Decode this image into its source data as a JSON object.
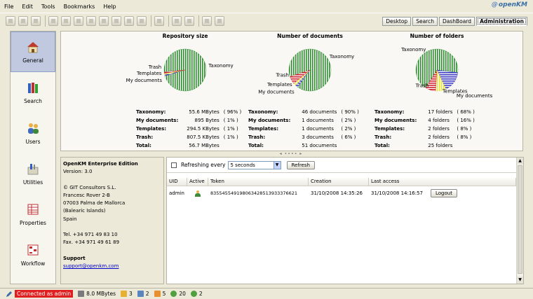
{
  "menu": [
    "File",
    "Edit",
    "Tools",
    "Bookmarks",
    "Help"
  ],
  "logo": "openKM",
  "tabs": [
    "Desktop",
    "Search",
    "DashBoard",
    "Administration"
  ],
  "active_tab": "Administration",
  "nav": [
    {
      "label": "General",
      "icon": "house-icon",
      "active": true
    },
    {
      "label": "Search",
      "icon": "books-icon"
    },
    {
      "label": "Users",
      "icon": "users-icon"
    },
    {
      "label": "Utilities",
      "icon": "tools-icon"
    },
    {
      "label": "Properties",
      "icon": "properties-icon"
    },
    {
      "label": "Workflow",
      "icon": "workflow-icon"
    }
  ],
  "colors": {
    "taxonomy": "#2c8f2c",
    "my_documents": "#3a3ac0",
    "templates": "#e8e830",
    "trash": "#d02030"
  },
  "charts": [
    {
      "title": "Repository size",
      "labels": {
        "trash": "Trash",
        "templates": "Templates",
        "mydocs": "My documents",
        "taxonomy": "Taxonomy"
      },
      "rows": [
        {
          "label": "Taxonomy:",
          "value": "55.6 MBytes",
          "pct": "( 96% )"
        },
        {
          "label": "My documents:",
          "value": "895 Bytes",
          "pct": "( 1% )"
        },
        {
          "label": "Templates:",
          "value": "294.5 KBytes",
          "pct": "( 1% )"
        },
        {
          "label": "Trash:",
          "value": "807.5 KBytes",
          "pct": "( 1% )"
        },
        {
          "label": "Total:",
          "value": "56.7 MBytes",
          "pct": ""
        }
      ]
    },
    {
      "title": "Number of documents",
      "labels": {
        "trash": "Trash",
        "templates": "Templates",
        "mydocs": "My documents",
        "taxonomy": "Taxonomy"
      },
      "rows": [
        {
          "label": "Taxonomy:",
          "value": "46 documents",
          "pct": "( 90% )"
        },
        {
          "label": "My documents:",
          "value": "1 documents",
          "pct": "( 2% )"
        },
        {
          "label": "Templates:",
          "value": "1 documents",
          "pct": "( 2% )"
        },
        {
          "label": "Trash:",
          "value": "3 documents",
          "pct": "( 6% )"
        },
        {
          "label": "Total:",
          "value": "51 documents",
          "pct": ""
        }
      ]
    },
    {
      "title": "Number of folders",
      "labels": {
        "trash": "Trash",
        "templates": "Templates",
        "mydocs": "My documents",
        "taxonomy": "Taxonomy"
      },
      "rows": [
        {
          "label": "Taxonomy:",
          "value": "17 folders",
          "pct": "( 68% )"
        },
        {
          "label": "My documents:",
          "value": "4 folders",
          "pct": "( 16% )"
        },
        {
          "label": "Templates:",
          "value": "2 folders",
          "pct": "( 8% )"
        },
        {
          "label": "Trash:",
          "value": "2 folders",
          "pct": "( 8% )"
        },
        {
          "label": "Total:",
          "value": "25 folders",
          "pct": ""
        }
      ]
    }
  ],
  "chart_data": [
    {
      "type": "pie",
      "title": "Repository size",
      "categories": [
        "Taxonomy",
        "My documents",
        "Templates",
        "Trash"
      ],
      "values": [
        96,
        1,
        1,
        1
      ]
    },
    {
      "type": "pie",
      "title": "Number of documents",
      "categories": [
        "Taxonomy",
        "My documents",
        "Templates",
        "Trash"
      ],
      "values": [
        90,
        2,
        2,
        6
      ]
    },
    {
      "type": "pie",
      "title": "Number of folders",
      "categories": [
        "Taxonomy",
        "My documents",
        "Templates",
        "Trash"
      ],
      "values": [
        68,
        16,
        8,
        8
      ]
    }
  ],
  "info": {
    "edition": "OpenKM Enterprise Edition",
    "version": "Version: 3.0",
    "address": [
      "© GIT Consultors S.L.",
      "Francesc Rover 2-B",
      "07003 Palma de Mallorca",
      "(Balearic Islands)",
      "Spain"
    ],
    "tel": "Tel. +34 971 49 83 10",
    "fax": "Fax. +34 971 49 61 89",
    "support_title": "Support",
    "support_email": "support@openkm.com"
  },
  "sessions": {
    "refresh_label": "Refreshing every",
    "interval": "5 seconds",
    "refresh_button": "Refresh",
    "columns": [
      "UID",
      "Active",
      "Token",
      "Creation",
      "Last access"
    ],
    "rows": [
      {
        "uid": "admin",
        "token": "835545549198063428513933376621",
        "creation": "31/10/2008 14:35:26",
        "last_access": "31/10/2008 14:16:57",
        "action": "Logout"
      }
    ]
  },
  "status": {
    "connected": "Connected as admin",
    "size": "8.0 MBytes",
    "counts": [
      "3",
      "2",
      "5",
      "20",
      "2"
    ]
  }
}
